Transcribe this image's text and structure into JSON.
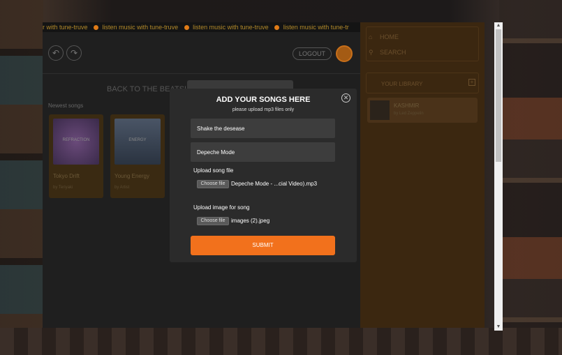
{
  "ticker": {
    "items": [
      "r with tune-truve",
      "listen music with tune-truve",
      "listen music with tune-truve",
      "listen music with tune-tr"
    ]
  },
  "header": {
    "logout_label": "LOGOUT",
    "back_title": "BACK TO THE BEATS!"
  },
  "main": {
    "newest_label": "Newest songs",
    "songs": [
      {
        "title": "Tokyo Drift",
        "artist": "by Teriyaki",
        "art_label": "REFRACTION"
      },
      {
        "title": "Young Energy",
        "artist": "by Artist",
        "art_label": "ENERGY"
      }
    ]
  },
  "sidebar": {
    "home_label": "HOME",
    "search_label": "SEARCH",
    "library_label": "YOUR LIBRARY",
    "library_items": [
      {
        "title": "KASHMIR",
        "subtitle": "by Led Zeppelin"
      }
    ]
  },
  "modal": {
    "title": "ADD YOUR SONGS HERE",
    "subtitle": "please upload mp3 files only",
    "song_name_value": "Shake the desease",
    "artist_value": "Depeche Mode",
    "upload_song_label": "Upload song file",
    "choose_file_label": "Choose file",
    "song_file_name": "Depeche Mode - ...cial Video).mp3",
    "upload_image_label": "Upload image for song",
    "image_file_name": "images (2).jpeg",
    "submit_label": "SUBMIT"
  },
  "colors": {
    "accent": "#f2711c",
    "modal_bg": "#2b2b2b",
    "field_bg": "#3d3d3d",
    "sidebar_bg": "#3b2710"
  }
}
